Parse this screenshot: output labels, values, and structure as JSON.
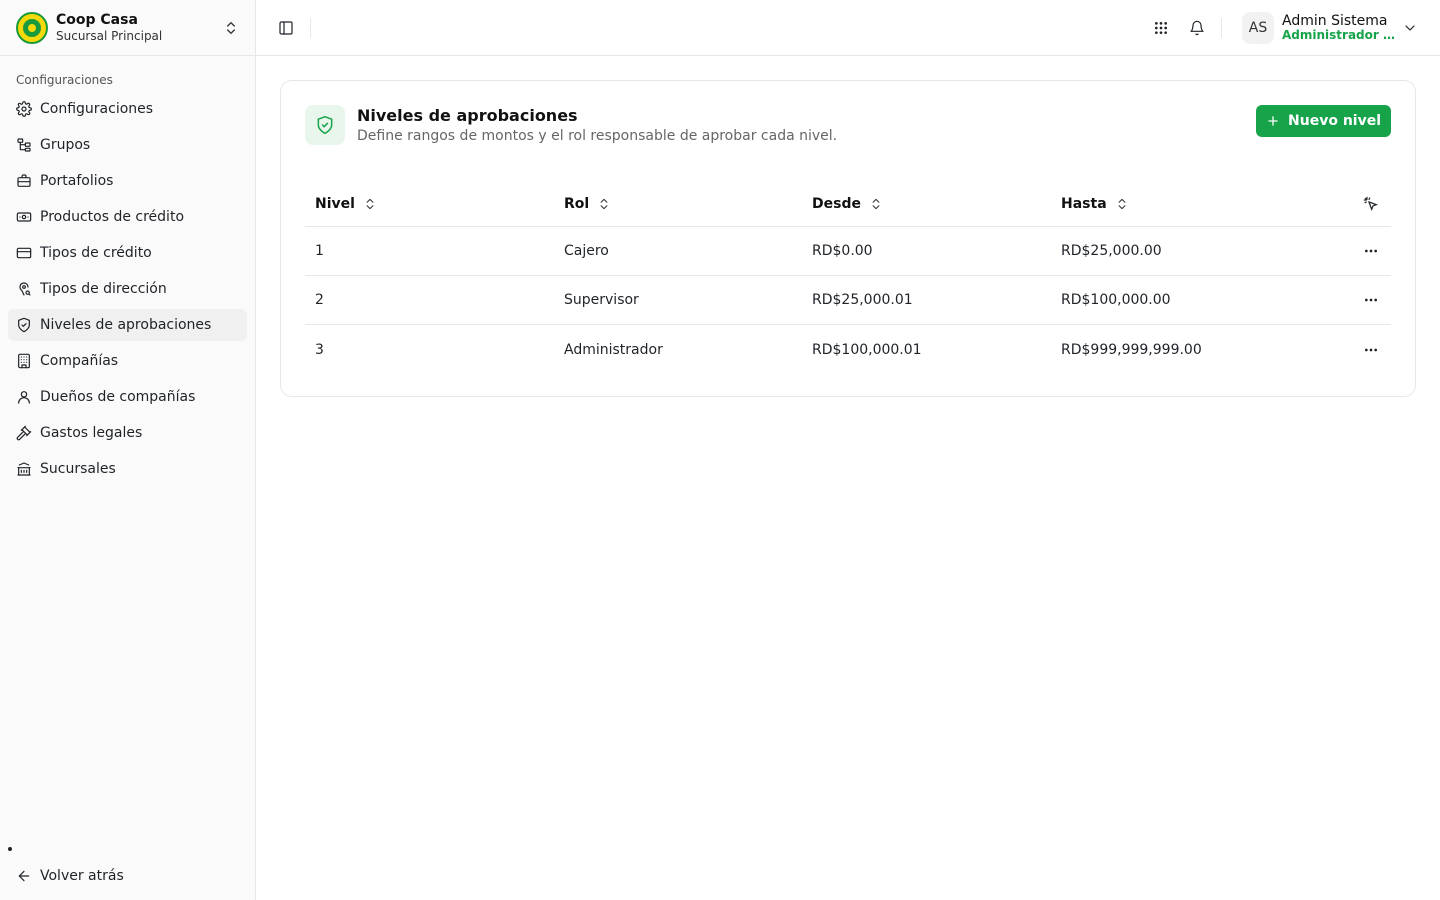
{
  "brand": {
    "name": "Coop Casa",
    "branch": "Sucursal Principal"
  },
  "sidebar": {
    "section": "Configuraciones",
    "items": [
      {
        "label": "Configuraciones",
        "icon": "gear-icon"
      },
      {
        "label": "Grupos",
        "icon": "group-tree-icon"
      },
      {
        "label": "Portafolios",
        "icon": "briefcase-icon"
      },
      {
        "label": "Productos de crédito",
        "icon": "banknote-icon"
      },
      {
        "label": "Tipos de crédito",
        "icon": "credit-card-icon"
      },
      {
        "label": "Tipos de dirección",
        "icon": "map-pin-search-icon"
      },
      {
        "label": "Niveles de aprobaciones",
        "icon": "shield-check-icon",
        "active": true
      },
      {
        "label": "Compañías",
        "icon": "building-icon"
      },
      {
        "label": "Dueños de compañías",
        "icon": "user-icon"
      },
      {
        "label": "Gastos legales",
        "icon": "gavel-icon"
      },
      {
        "label": "Sucursales",
        "icon": "bank-icon"
      }
    ],
    "back": "Volver atrás"
  },
  "header": {
    "user": {
      "initials": "AS",
      "name": "Admin Sistema",
      "role": "Administrador del sistema"
    }
  },
  "card": {
    "title": "Niveles de aprobaciones",
    "subtitle": "Define rangos de montos y el rol responsable de aprobar cada nivel.",
    "new_button": "Nuevo nivel"
  },
  "table": {
    "headers": [
      "Nivel",
      "Rol",
      "Desde",
      "Hasta"
    ],
    "rows": [
      [
        "1",
        "Cajero",
        "RD$0.00",
        "RD$25,000.00"
      ],
      [
        "2",
        "Supervisor",
        "RD$25,000.01",
        "RD$100,000.00"
      ],
      [
        "3",
        "Administrador",
        "RD$100,000.01",
        "RD$999,999,999.00"
      ]
    ]
  },
  "colors": {
    "accent": "#16a34a",
    "accent_soft": "#e8f6ec",
    "border": "#e5e7eb"
  }
}
